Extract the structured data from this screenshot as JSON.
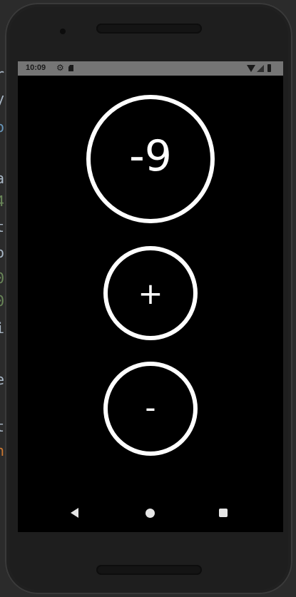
{
  "status_bar": {
    "time": "10:09",
    "icons": [
      "gear-icon",
      "sd-card-icon",
      "wifi-icon",
      "signal-icon",
      "battery-icon"
    ]
  },
  "counter": {
    "value": "-9"
  },
  "buttons": {
    "increment_label": "+",
    "decrement_label": "-"
  },
  "nav_bar": {
    "icons": [
      "back-icon",
      "home-icon",
      "recents-icon"
    ]
  },
  "colors": {
    "screen_background": "#000000",
    "foreground": "#ffffff",
    "status_bar": "#757575",
    "device_frame": "#1e1e1e"
  }
}
